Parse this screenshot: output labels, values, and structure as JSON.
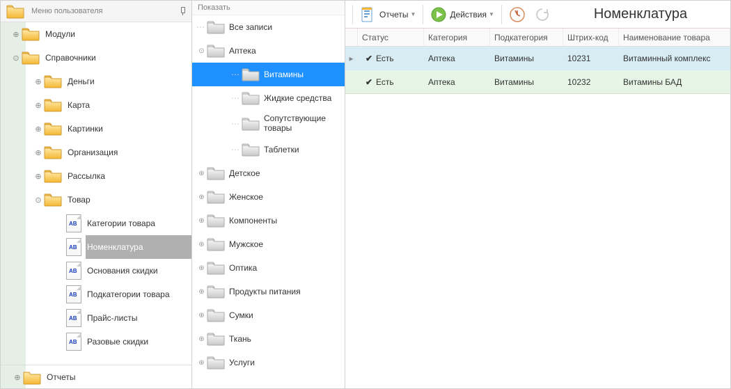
{
  "sidebar": {
    "title": "Меню пользователя",
    "items": [
      {
        "label": "Модули",
        "icon": "folder",
        "depth": 0,
        "tog": "plus"
      },
      {
        "label": "Справочники",
        "icon": "folder",
        "depth": 0,
        "tog": "down"
      },
      {
        "label": "Деньги",
        "icon": "folder",
        "depth": 1,
        "tog": "plus"
      },
      {
        "label": "Карта",
        "icon": "folder",
        "depth": 1,
        "tog": "plus"
      },
      {
        "label": "Картинки",
        "icon": "folder",
        "depth": 1,
        "tog": "plus"
      },
      {
        "label": "Организация",
        "icon": "folder",
        "depth": 1,
        "tog": "plus"
      },
      {
        "label": "Рассылка",
        "icon": "folder",
        "depth": 1,
        "tog": "plus"
      },
      {
        "label": "Товар",
        "icon": "folder",
        "depth": 1,
        "tog": "down"
      },
      {
        "label": "Категории товара",
        "icon": "doc",
        "depth": 2
      },
      {
        "label": "Номенклатура",
        "icon": "doc",
        "depth": 2,
        "selected": true
      },
      {
        "label": "Основания скидки",
        "icon": "doc",
        "depth": 2
      },
      {
        "label": "Подкатегории товара",
        "icon": "doc",
        "depth": 2
      },
      {
        "label": "Прайс-листы",
        "icon": "doc",
        "depth": 2
      },
      {
        "label": "Разовые скидки",
        "icon": "doc",
        "depth": 2
      }
    ],
    "footer": {
      "label": "Отчеты",
      "tog": "plus"
    }
  },
  "show_panel": {
    "title": "Показать",
    "items": [
      {
        "label": "Все записи",
        "depth": 0,
        "tog": "dots"
      },
      {
        "label": "Аптека",
        "depth": 0,
        "tog": "minus"
      },
      {
        "label": "Витамины",
        "depth": 1,
        "tog": "dots",
        "selected": true
      },
      {
        "label": "Жидкие средства",
        "depth": 1,
        "tog": "dots"
      },
      {
        "label": "Сопутствующие товары",
        "depth": 1,
        "tog": "dots",
        "tall": true
      },
      {
        "label": "Таблетки",
        "depth": 1,
        "tog": "dots"
      },
      {
        "label": "Детское",
        "depth": 0,
        "tog": "plus"
      },
      {
        "label": "Женское",
        "depth": 0,
        "tog": "plus"
      },
      {
        "label": "Компоненты",
        "depth": 0,
        "tog": "plus"
      },
      {
        "label": "Мужское",
        "depth": 0,
        "tog": "plus"
      },
      {
        "label": "Оптика",
        "depth": 0,
        "tog": "plus"
      },
      {
        "label": "Продукты питания",
        "depth": 0,
        "tog": "plus"
      },
      {
        "label": "Сумки",
        "depth": 0,
        "tog": "plus"
      },
      {
        "label": "Ткань",
        "depth": 0,
        "tog": "plus"
      },
      {
        "label": "Услуги",
        "depth": 0,
        "tog": "plus"
      }
    ]
  },
  "toolbar": {
    "reports": "Отчеты",
    "actions": "Действия"
  },
  "title": "Номенклатура",
  "grid": {
    "columns": [
      "Статус",
      "Категория",
      "Подкатегория",
      "Штрих-код",
      "Наименование товара"
    ],
    "rows": [
      {
        "status_check": true,
        "status": "Есть",
        "category": "Аптека",
        "subcategory": "Витамины",
        "barcode": "10231",
        "name": "Витаминный комплекс"
      },
      {
        "status_check": true,
        "status": "Есть",
        "category": "Аптека",
        "subcategory": "Витамины",
        "barcode": "10232",
        "name": "Витамины БАД"
      }
    ]
  },
  "doc_ab": "AB"
}
